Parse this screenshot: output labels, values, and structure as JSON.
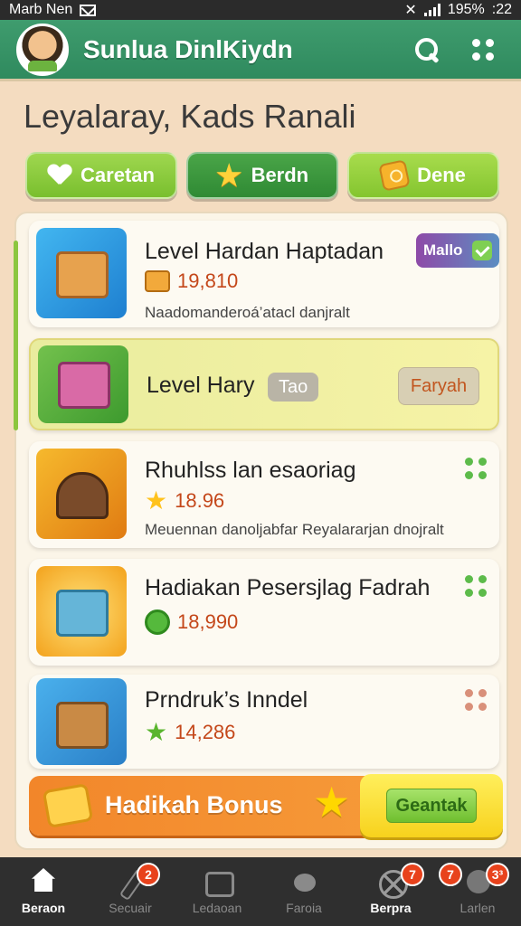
{
  "status_bar": {
    "carrier": "Marb Nen",
    "battery": "195%",
    "time": ":22"
  },
  "header": {
    "title": "Sunlua DinlKiydn",
    "accent_color": "#3f9c6e"
  },
  "page": {
    "heading": "Leyalaray, Kads Ranali"
  },
  "filters": [
    {
      "label": "Caretan",
      "icon": "heart-icon"
    },
    {
      "label": "Berdn",
      "icon": "star-icon"
    },
    {
      "label": "Dene",
      "icon": "ticket-icon"
    }
  ],
  "items": [
    {
      "title": "Level Hardan Haptadan",
      "value": "19,810",
      "desc": "Naadomanderoá’atacl danjralt",
      "badge": "Mallo"
    },
    {
      "title": "Level Hary",
      "tag": "Tao",
      "action": "Faryah"
    },
    {
      "title": "Rhuhlss lan esaoriag",
      "value": "18.96",
      "desc": "Meuennan danoljabfar Reyalararjan dnojralt"
    },
    {
      "title": "Hadiakan Pesersjlag Fadrah",
      "value": "18,990"
    },
    {
      "title": "Prndruk’s Inndel",
      "value": "14,286"
    }
  ],
  "bonus": {
    "label": "Hadikah Bonus",
    "button": "Geantak"
  },
  "bottom_nav": [
    {
      "label": "Beraon",
      "icon": "home-icon",
      "badge": ""
    },
    {
      "label": "Secuair",
      "icon": "pen-icon",
      "badge": "2"
    },
    {
      "label": "Ledaoan",
      "icon": "box-icon",
      "badge": ""
    },
    {
      "label": "Faroia",
      "icon": "blob-icon",
      "badge": ""
    },
    {
      "label": "Berpra",
      "icon": "x-icon",
      "badge": "7"
    },
    {
      "label": "Larlen",
      "icon": "paw-icon",
      "badge": "7",
      "badge2": "3³"
    }
  ]
}
